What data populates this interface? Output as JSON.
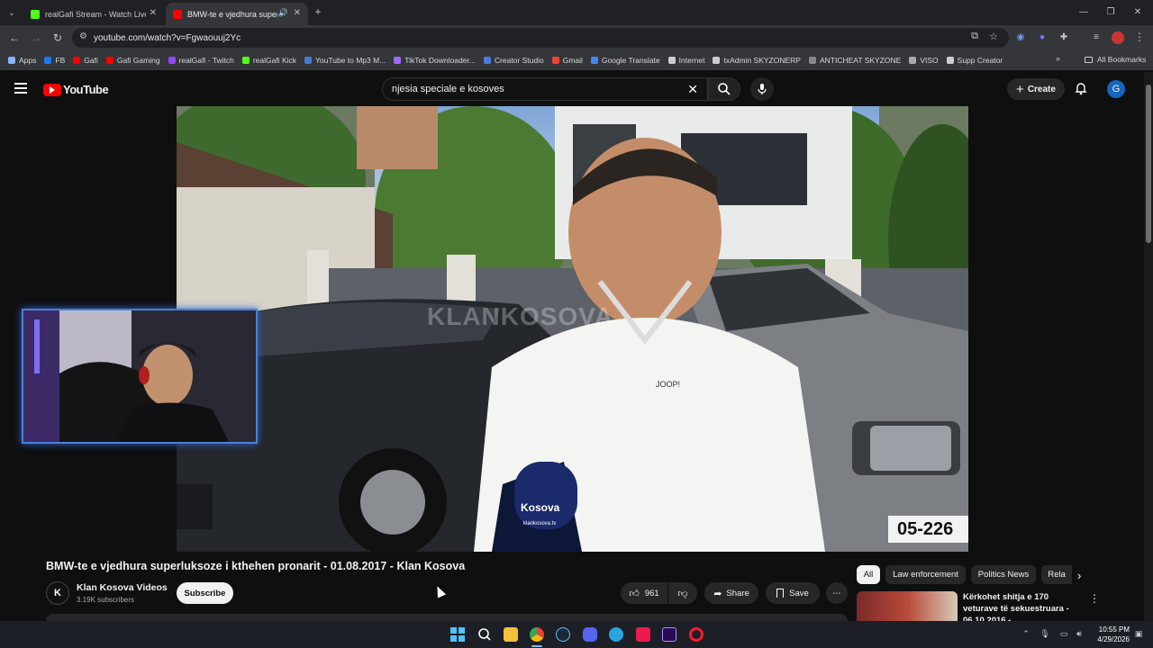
{
  "tabs": [
    {
      "title": "realGafi Stream - Watch Live on Kick",
      "icon": "kick-icon",
      "color": "#53fc18"
    },
    {
      "title": "BMW-te e vjedhura superluksoze i kthehen pronarit",
      "icon": "youtube-icon",
      "color": "#ff0000"
    }
  ],
  "address": "youtube.com/watch?v=Fgwaouuj2Yc",
  "bookmarks": [
    {
      "label": "Apps",
      "color": "#8ab4f8"
    },
    {
      "label": "FB",
      "color": "#1877f2"
    },
    {
      "label": "Gafi",
      "color": "#ff0000"
    },
    {
      "label": "Gafi Gaming",
      "color": "#ff0000"
    },
    {
      "label": "realGafi - Twitch",
      "color": "#9146ff"
    },
    {
      "label": "realGafi Kick",
      "color": "#53fc18"
    },
    {
      "label": "YouTube to Mp3 M...",
      "color": "#3f7bd1"
    },
    {
      "label": "TikTok Downloader...",
      "color": "#9a6cff"
    },
    {
      "label": "Creator Studio",
      "color": "#4a7bd9"
    },
    {
      "label": "Gmail",
      "color": "#ea4335"
    },
    {
      "label": "Google Translate",
      "color": "#4285f4"
    },
    {
      "label": "Internet",
      "color": "#cccccc"
    },
    {
      "label": "txAdmin SKYZONERP",
      "color": "#cccccc"
    },
    {
      "label": "ANTICHEAT SKYZONE",
      "color": "#888888"
    },
    {
      "label": "VISO",
      "color": "#aaaaaa"
    },
    {
      "label": "Supp Creator",
      "color": "#cccccc"
    }
  ],
  "all_bookmarks": "All Bookmarks",
  "yt": {
    "logo": "YouTube",
    "search_value": "njesia speciale e kosoves",
    "create": "Create",
    "avatar": "G",
    "watermark": "KLANKOSOVA",
    "video_title": "BMW-te e vjedhura superluksoze i kthehen pronarit - 01.08.2017 - Klan Kosova",
    "channel": "Klan Kosova Videos",
    "subscribers": "3.19K subscribers",
    "subscribe": "Subscribe",
    "likes": "961",
    "share": "Share",
    "save": "Save",
    "chips": [
      "All",
      "Law enforcement",
      "Politics News",
      "Rela"
    ],
    "rec_title": "Kërkohet shitja e 170 veturave të sekuestruara - 06.10.2016 -..."
  },
  "tray": {
    "time": "10:55 PM",
    "date": "4/29/2026"
  }
}
